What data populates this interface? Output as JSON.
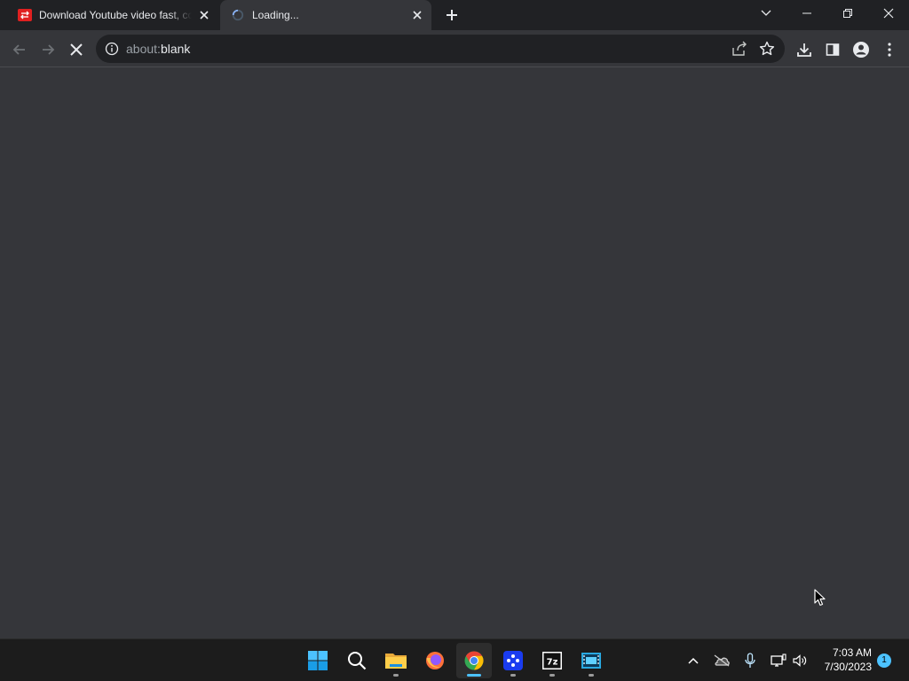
{
  "browser": {
    "tabs": [
      {
        "title": "Download Youtube video fast, co",
        "favicon": "red-download-icon",
        "active": false
      },
      {
        "title": "Loading...",
        "favicon": "loading-spinner-icon",
        "active": true
      }
    ],
    "address_bar": {
      "scheme": "about:",
      "rest": "blank"
    }
  },
  "taskbar": {
    "apps": [
      "windows-start",
      "search",
      "file-explorer",
      "firefox",
      "chrome",
      "app-blue",
      "7zip",
      "video-editor"
    ],
    "clock": {
      "time": "7:03 AM",
      "date": "7/30/2023"
    },
    "notification_count": "1"
  },
  "colors": {
    "tab_strip": "#202124",
    "toolbar": "#35363a",
    "omnibox": "#202124",
    "taskbar": "#1c1c1c",
    "accent": "#4cc2ff"
  }
}
